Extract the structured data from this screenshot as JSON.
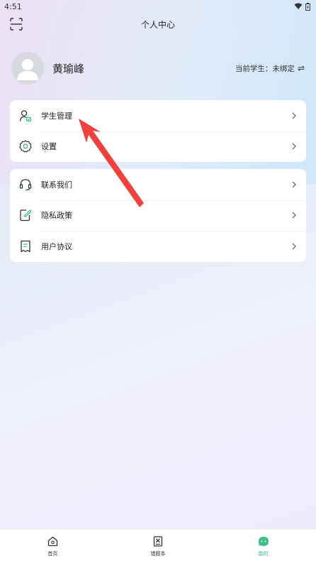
{
  "status_bar": {
    "time": "4:51"
  },
  "header": {
    "title": "个人中心"
  },
  "profile": {
    "name": "黄瑜峰",
    "student_label": "当前学生：未绑定",
    "swap_glyph": "⇌"
  },
  "menu_group_1": [
    {
      "label": "学生管理",
      "icon": "student-icon"
    },
    {
      "label": "设置",
      "icon": "gear-icon"
    }
  ],
  "menu_group_2": [
    {
      "label": "联系我们",
      "icon": "headset-icon"
    },
    {
      "label": "隐私政策",
      "icon": "pen-note-icon"
    },
    {
      "label": "用户协议",
      "icon": "document-icon"
    }
  ],
  "tabs": [
    {
      "label": "首页",
      "icon": "home-icon",
      "active": false
    },
    {
      "label": "错题本",
      "icon": "wrong-book-icon",
      "active": false
    },
    {
      "label": "我的",
      "icon": "chat-bubble-icon",
      "active": true
    }
  ],
  "colors": {
    "accent": "#3fbf8a",
    "annotation_arrow": "#f0413e",
    "icon_stroke": "#333333"
  }
}
